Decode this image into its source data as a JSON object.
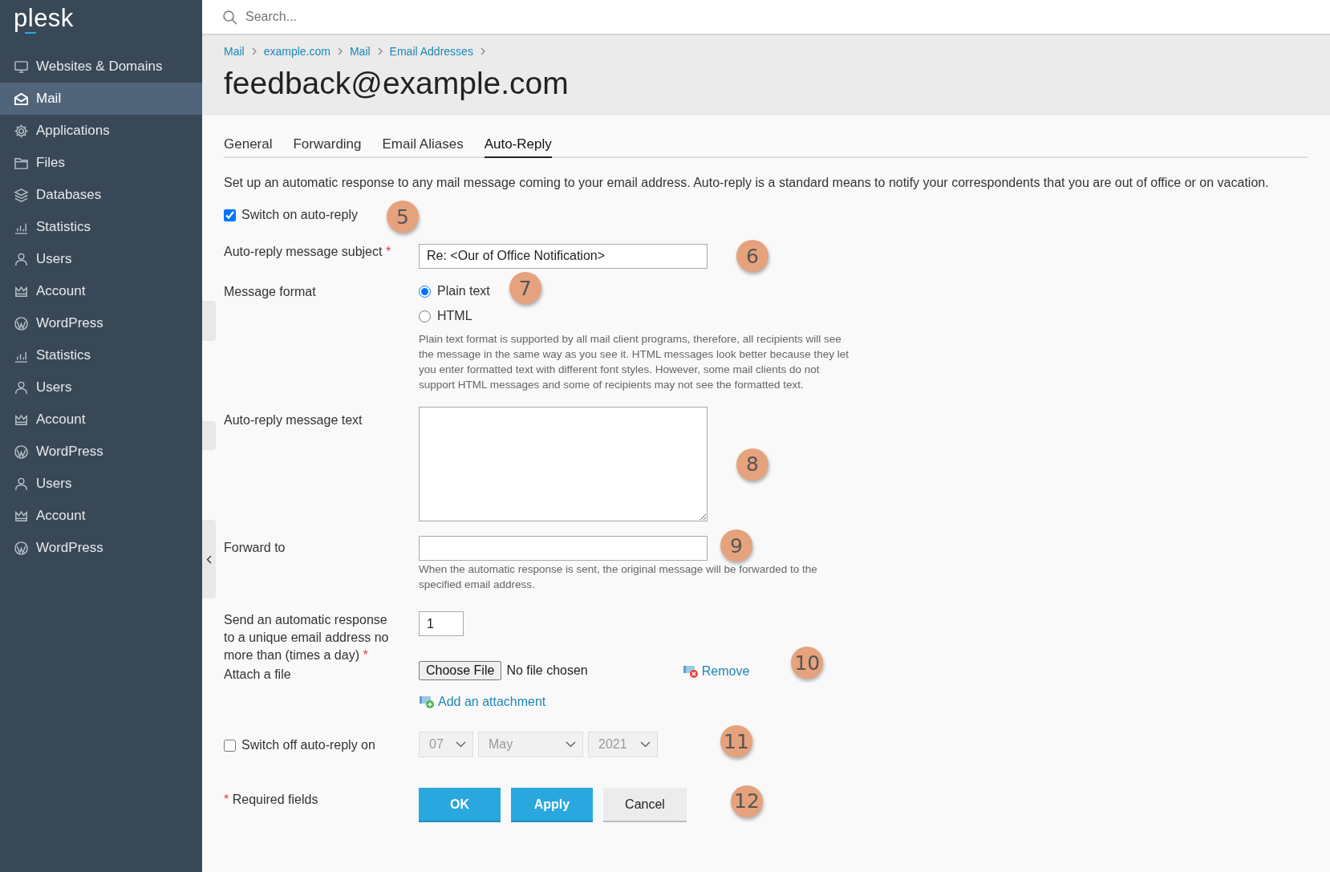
{
  "logo": "plesk",
  "sidebar": {
    "items": [
      {
        "label": "Websites & Domains",
        "kind": "websites",
        "selected": false
      },
      {
        "label": "Mail",
        "kind": "mail",
        "selected": true
      },
      {
        "label": "Applications",
        "kind": "applications",
        "selected": false
      },
      {
        "label": "Files",
        "kind": "files",
        "selected": false
      },
      {
        "label": "Databases",
        "kind": "databases",
        "selected": false
      },
      {
        "label": "Statistics",
        "kind": "statistics",
        "selected": false
      },
      {
        "label": "Users",
        "kind": "users",
        "selected": false
      },
      {
        "label": "Account",
        "kind": "account",
        "selected": false
      },
      {
        "label": "WordPress",
        "kind": "wordpress",
        "selected": false
      },
      {
        "label": "Statistics",
        "kind": "statistics",
        "selected": false
      },
      {
        "label": "Users",
        "kind": "users",
        "selected": false
      },
      {
        "label": "Account",
        "kind": "account",
        "selected": false
      },
      {
        "label": "WordPress",
        "kind": "wordpress",
        "selected": false
      },
      {
        "label": "Users",
        "kind": "users",
        "selected": false
      },
      {
        "label": "Account",
        "kind": "account",
        "selected": false
      },
      {
        "label": "WordPress",
        "kind": "wordpress",
        "selected": false
      }
    ]
  },
  "search": {
    "placeholder": "Search..."
  },
  "breadcrumbs": [
    "Mail",
    "example.com",
    "Mail",
    "Email Addresses"
  ],
  "page_title": "feedback@example.com",
  "tabs": [
    {
      "label": "General",
      "selected": false
    },
    {
      "label": "Forwarding",
      "selected": false
    },
    {
      "label": "Email Aliases",
      "selected": false
    },
    {
      "label": "Auto-Reply",
      "selected": true
    }
  ],
  "intro": "Set up an automatic response to any mail message coming to your email address. Auto-reply is a standard means to notify your correspondents that you are out of office or on vacation.",
  "switch_on": {
    "label": "Switch on auto-reply",
    "checked": true,
    "callout": "5"
  },
  "subject": {
    "label": "Auto-reply message subject",
    "mark": "*",
    "value": "Re: <Our of Office Notification>",
    "callout": "6"
  },
  "format": {
    "label": "Message format",
    "options": [
      {
        "label": "Plain text",
        "selected": true
      },
      {
        "label": "HTML",
        "selected": false
      }
    ],
    "hint": "Plain text format is supported by all mail client programs, therefore, all recipients will see the message in the same way as you see it. HTML messages look better because they let you enter formatted text with different font styles. However, some mail clients do not support HTML messages and some of recipients may not see the formatted text.",
    "callout": "7"
  },
  "message_text": {
    "label": "Auto-reply message text",
    "callout": "8"
  },
  "forward_to": {
    "label": "Forward to",
    "hint": "When the automatic response is sent, the original message will be forwarded to the specified email address.",
    "callout": "9"
  },
  "frequency": {
    "label": "Send an automatic response to a unique email address no more than (times a day)",
    "mark": "*",
    "value": "1"
  },
  "attach": {
    "label": "Attach a file",
    "button": "Choose File",
    "status": "No file chosen",
    "remove": "Remove",
    "add": "Add an attachment",
    "callout": "10"
  },
  "switch_off": {
    "label": "Switch off auto-reply on",
    "checked": false,
    "disabled": true,
    "day": "07",
    "month": "May",
    "year": "2021",
    "callout": "11"
  },
  "required_note": {
    "mark": "*",
    "label": "Required fields"
  },
  "buttons": [
    {
      "label": "OK",
      "kind": "primary"
    },
    {
      "label": "Apply",
      "kind": "primary"
    },
    {
      "label": "Cancel",
      "kind": "secondary"
    }
  ],
  "buttons_callout": "12"
}
